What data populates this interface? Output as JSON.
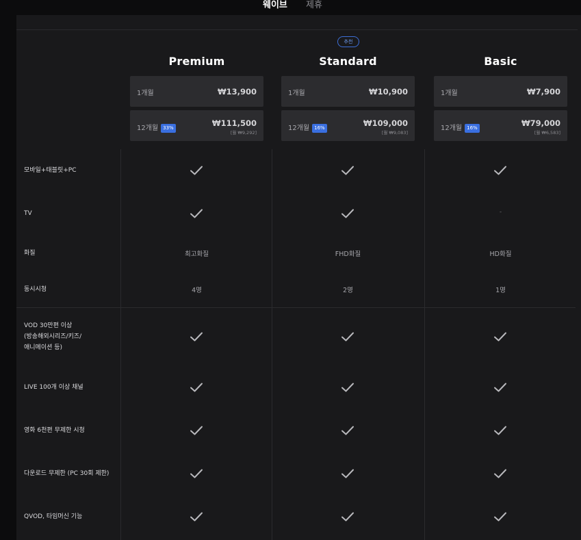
{
  "tabs": [
    {
      "label": "웨이브",
      "active": true
    },
    {
      "label": "제휴",
      "active": false
    }
  ],
  "recommended_badge": "추천",
  "plans": [
    {
      "name": "Premium",
      "monthly": {
        "period": "1개월",
        "price": "₩13,900"
      },
      "yearly": {
        "period": "12개월",
        "discount": "33%",
        "price": "₩111,500",
        "per_month": "[월 ₩9,292]"
      }
    },
    {
      "name": "Standard",
      "recommended": true,
      "monthly": {
        "period": "1개월",
        "price": "₩10,900"
      },
      "yearly": {
        "period": "12개월",
        "discount": "16%",
        "price": "₩109,000",
        "per_month": "[월 ₩9,083]"
      }
    },
    {
      "name": "Basic",
      "monthly": {
        "period": "1개월",
        "price": "₩7,900"
      },
      "yearly": {
        "period": "12개월",
        "discount": "16%",
        "price": "₩79,000",
        "per_month": "[월 ₩6,583]"
      }
    }
  ],
  "features": [
    {
      "label": "모바일+태블릿+PC",
      "values": [
        "check",
        "check",
        "check"
      ]
    },
    {
      "label": "TV",
      "values": [
        "check",
        "check",
        "-"
      ]
    },
    {
      "label": "화질",
      "values": [
        "최고화질",
        "FHD화질",
        "HD화질"
      ]
    },
    {
      "label": "동시시청",
      "values": [
        "4명",
        "2명",
        "1명"
      ]
    },
    {
      "label": "VOD 30만편 이상\n(방송해외시리즈/키즈/\n애니메이션 등)",
      "values": [
        "check",
        "check",
        "check"
      ]
    },
    {
      "label": "LIVE 100개 이상 채널",
      "values": [
        "check",
        "check",
        "check"
      ]
    },
    {
      "label": "영화 6천편 무제한 시청",
      "values": [
        "check",
        "check",
        "check"
      ]
    },
    {
      "label": "다운로드 무제한 (PC 30회 제한)",
      "values": [
        "check",
        "check",
        "check"
      ]
    },
    {
      "label": "QVOD, 타임머신 기능",
      "values": [
        "check",
        "check",
        "check"
      ]
    }
  ],
  "colors": {
    "background": "#19191b",
    "accent": "#3a6fe0",
    "card": "#2c2c2f"
  },
  "icons": {
    "check": "check-icon"
  }
}
